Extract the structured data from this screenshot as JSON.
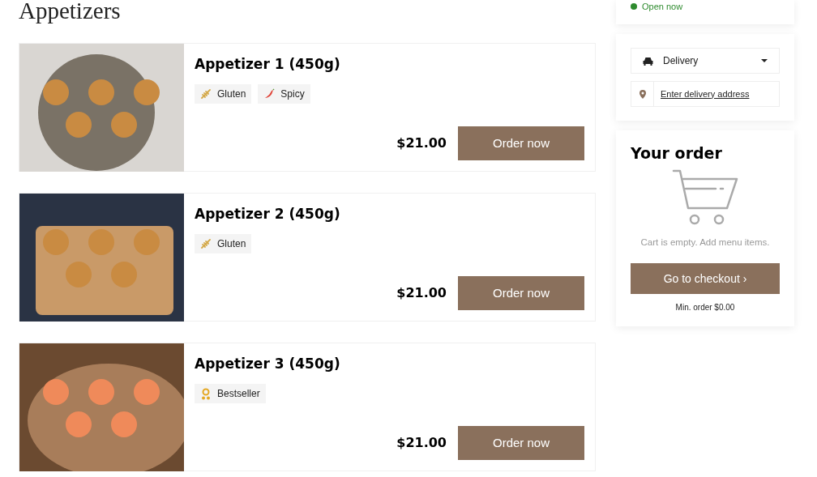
{
  "section_title": "Appetizers",
  "items": [
    {
      "name": "Appetizer 1 (450g)",
      "tags": [
        {
          "kind": "gluten",
          "label": "Gluten"
        },
        {
          "kind": "spicy",
          "label": "Spicy"
        }
      ],
      "price": "$21.00",
      "button": "Order now"
    },
    {
      "name": "Appetizer 2 (450g)",
      "tags": [
        {
          "kind": "gluten",
          "label": "Gluten"
        }
      ],
      "price": "$21.00",
      "button": "Order now"
    },
    {
      "name": "Appetizer 3 (450g)",
      "tags": [
        {
          "kind": "bestseller",
          "label": "Bestseller"
        }
      ],
      "price": "$21.00",
      "button": "Order now"
    }
  ],
  "status": {
    "label": "Open now",
    "color": "#2e8b2e"
  },
  "delivery": {
    "mode": "Delivery",
    "address_link": "Enter delivery address"
  },
  "order": {
    "title": "Your order",
    "empty_text": "Cart is empty. Add menu items.",
    "checkout": "Go to checkout ›",
    "min_order": "Min. order $0.00"
  }
}
